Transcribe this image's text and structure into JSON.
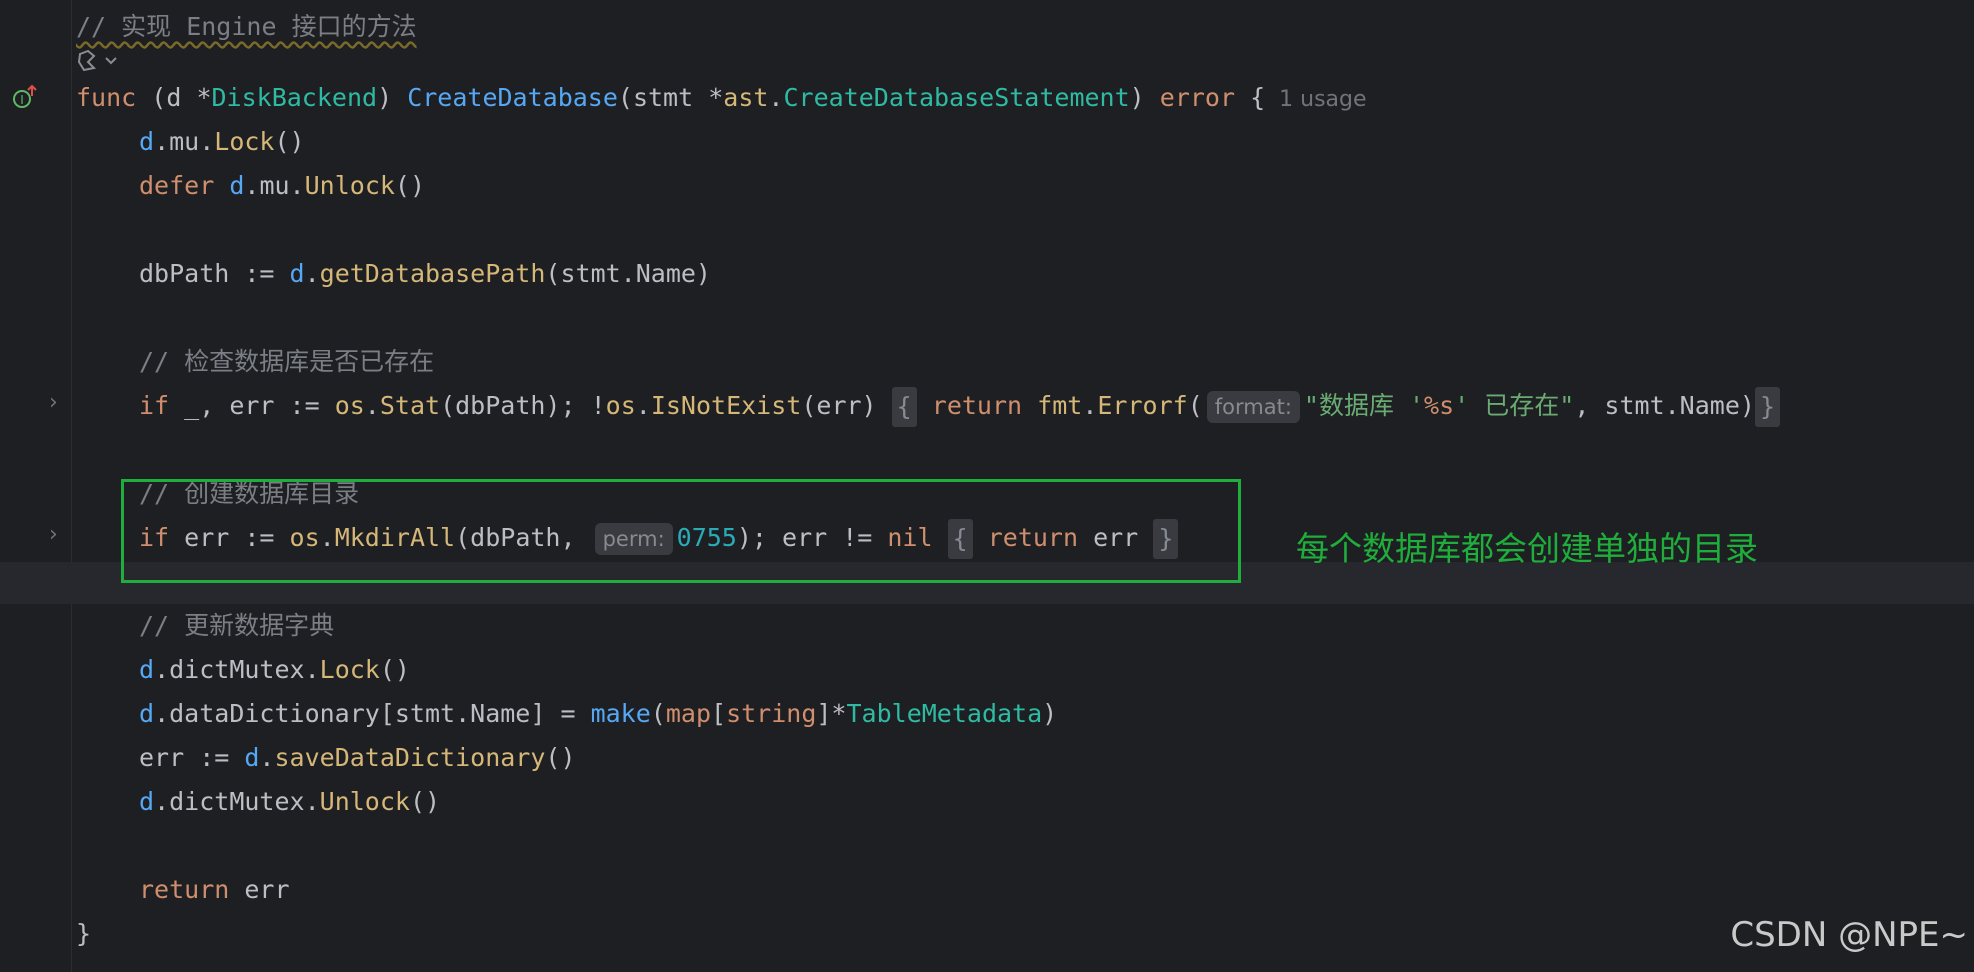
{
  "editor": {
    "header_comment": "// 实现 Engine 接口的方法",
    "usage_hint": "1 usage",
    "sig": {
      "func": "func",
      "open": " (",
      "recv": "d",
      "star": " *",
      "recv_type": "DiskBackend",
      "close": ") ",
      "name": "CreateDatabase",
      "p_open": "(stmt *",
      "pkg": "ast",
      "dot": ".",
      "param_type": "CreateDatabaseStatement",
      "p_close": ") ",
      "ret": "error",
      "brace": " {"
    },
    "l_lock": {
      "recv": "d",
      "mid": ".mu.",
      "method": "Lock",
      "tail": "()"
    },
    "l_defer": {
      "kw": "defer",
      "sp": " ",
      "recv": "d",
      "mid": ".mu.",
      "method": "Unlock",
      "tail": "()"
    },
    "l_dbpath": {
      "pre": "dbPath := ",
      "recv": "d",
      "dot": ".",
      "method": "getDatabasePath",
      "tail": "(stmt.Name)"
    },
    "comment_check": "// 检查数据库是否已存在",
    "l_if1": {
      "kw": "if",
      "a": " _, err := ",
      "pkg": "os",
      "dot1": ".",
      "m1": "Stat",
      "b": "(dbPath); !",
      "pkg2": "os",
      "dot2": ".",
      "m2": "IsNotExist",
      "c": "(err) ",
      "fold_open": "{",
      "ret": "return",
      "sp": " ",
      "pkg3": "fmt",
      "dot3": ".",
      "m3": "Errorf",
      "paren": "(",
      "hint": "format:",
      "str": "\"数据库 '",
      "fmt": "%s",
      "str2": "' 已存在\"",
      "d": ", stmt.Name)",
      "fold_close": "}"
    },
    "comment_mkdir": "// 创建数据库目录",
    "l_if2": {
      "kw": "if",
      "a": " err := ",
      "pkg": "os",
      "dot": ".",
      "m": "MkdirAll",
      "b": "(dbPath, ",
      "hint": "perm:",
      "num": "0755",
      "c": "); err != ",
      "nil": "nil",
      "sp": " ",
      "fold_open": "{",
      "ret": "return",
      "d": " err",
      "fold_close": "}"
    },
    "comment_dict": "// 更新数据字典",
    "l_dlock": {
      "recv": "d",
      "mid": ".dictMutex.",
      "method": "Lock",
      "tail": "()"
    },
    "l_dict": {
      "recv": "d",
      "a": ".dataDictionary[stmt.Name] = ",
      "make": "make",
      "p": "(",
      "map": "map",
      "lb": "[",
      "str": "string",
      "rb": "]*",
      "type": "TableMetadata",
      "e": ")"
    },
    "l_err": {
      "pre": "err := ",
      "recv": "d",
      "dot": ".",
      "method": "saveDataDictionary",
      "tail": "()"
    },
    "l_dunlock": {
      "recv": "d",
      "mid": ".dictMutex.",
      "method": "Unlock",
      "tail": "()"
    },
    "l_return": {
      "kw": "return",
      "tail": " err"
    },
    "close_brace": "}"
  },
  "annotation": "每个数据库都会创建单独的目录",
  "watermark": "CSDN @NPE~",
  "colors": {
    "background": "#1e1f22",
    "keyword": "#cf8e6d",
    "function": "#56a8f5",
    "method": "#d5b778",
    "type": "#2fbaa3",
    "comment": "#7a7e85",
    "string": "#6aab73",
    "number": "#2aacb8",
    "highlight_box": "#1fae3b"
  }
}
